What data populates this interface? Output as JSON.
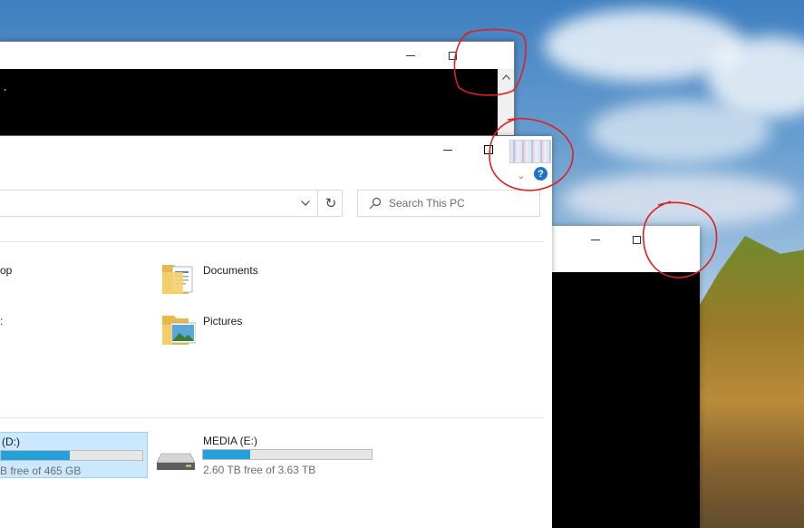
{
  "window_controls": {
    "minimize_glyph": "—",
    "maximize_glyph": "□"
  },
  "console_window": {
    "text": "."
  },
  "explorer": {
    "search_placeholder": "Search This PC",
    "address_dropdown_glyph": "⌄",
    "refresh_glyph": "↻",
    "help_glyph": "?",
    "ribbon_chevron_glyph": "⌄",
    "folders": [
      {
        "label": "op",
        "icon": "desktop-folder-icon"
      },
      {
        "label": "Documents",
        "icon": "documents-folder-icon"
      },
      {
        "label": ":",
        "icon": "folder-icon"
      },
      {
        "label": "Pictures",
        "icon": "pictures-folder-icon"
      }
    ],
    "drives": [
      {
        "name": "(D:)",
        "free_text": "B free of 465 GB",
        "used_fraction": 0.49,
        "selected": true
      },
      {
        "name": "MEDIA (E:)",
        "free_text": "2.60 TB free of 3.63 TB",
        "used_fraction": 0.28,
        "selected": false
      }
    ]
  },
  "colors": {
    "drive_fill": "#26a0da",
    "selected_tile": "#cce8ff",
    "annotation": "#e02020",
    "help_blue": "#1e72c8"
  }
}
